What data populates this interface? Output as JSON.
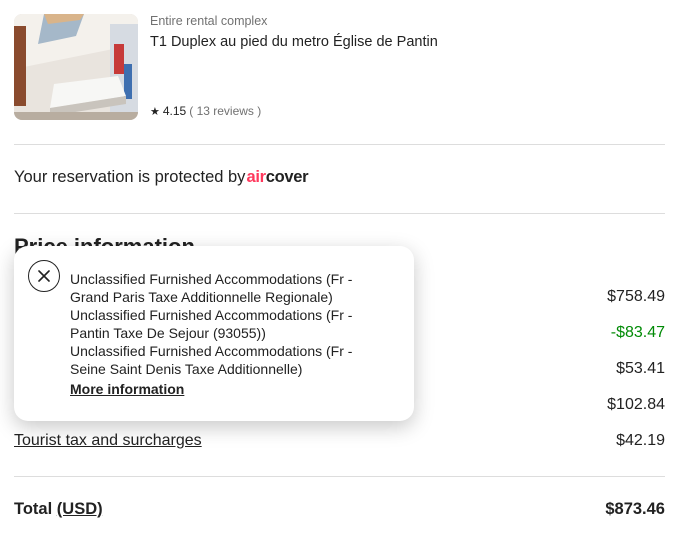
{
  "listing": {
    "type": "Entire rental complex",
    "title": "T1 Duplex au pied du metro Église de Pantin",
    "rating": "4.15",
    "reviews": "( 13 reviews )"
  },
  "protection": {
    "text": "Your reservation is protected by",
    "brand_air": "air",
    "brand_cover": "cover"
  },
  "price_details": {
    "heading": "Price information",
    "rows": [
      {
        "label": "",
        "amount": "$758.49"
      },
      {
        "label": "",
        "amount": "-$83.47"
      },
      {
        "label": "",
        "amount": "$53.41"
      },
      {
        "label": "",
        "amount": "$102.84"
      },
      {
        "label": "Tourist tax and surcharges",
        "amount": "$42.19"
      }
    ],
    "total_label": "Total",
    "total_currency": "(USD)",
    "total_amount": "$873.46"
  },
  "popover": {
    "lines": [
      "Unclassified Furnished Accommodations (Fr - Grand Paris Taxe Additionnelle Regionale)",
      "Unclassified Furnished Accommodations (Fr - Pantin Taxe De Sejour (93055))",
      "Unclassified Furnished Accommodations (Fr - Seine Saint Denis Taxe Additionnelle)"
    ],
    "more_info": "More information"
  },
  "colors": {
    "brand": "#ff385c",
    "credit": "#008a05",
    "muted": "#717171"
  },
  "icons": {
    "star": "star-icon",
    "close": "close-icon"
  }
}
